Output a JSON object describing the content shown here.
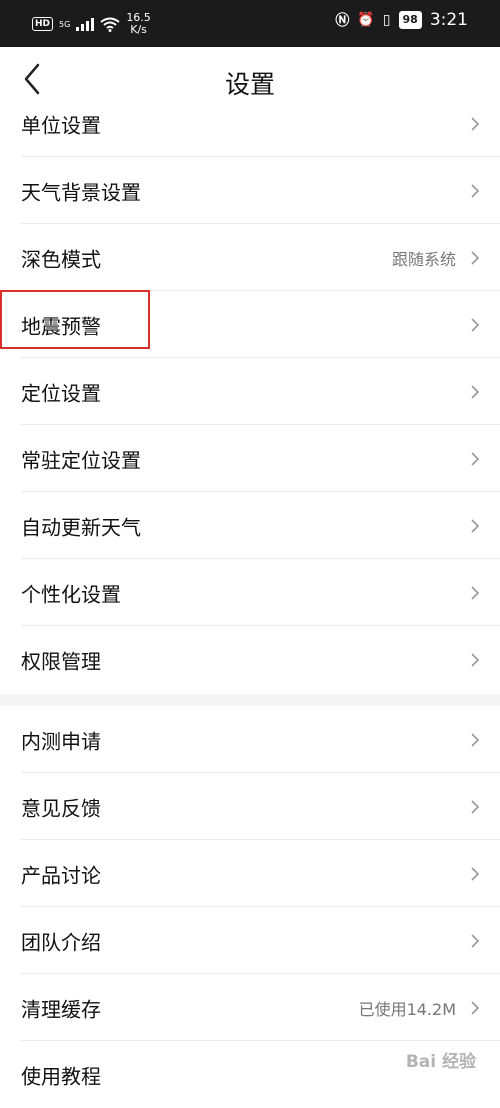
{
  "status_bar": {
    "hd": "HD",
    "network": "5G",
    "speed_value": "16.5",
    "speed_unit": "K/s",
    "battery": "98",
    "time": "3:21"
  },
  "header": {
    "title": "设置",
    "back_icon": "back-chevron-icon"
  },
  "settings": {
    "group1": [
      {
        "label": "单位设置"
      },
      {
        "label": "天气背景设置"
      },
      {
        "label": "深色模式",
        "value": "跟随系统"
      },
      {
        "label": "地震预警"
      },
      {
        "label": "定位设置"
      },
      {
        "label": "常驻定位设置"
      },
      {
        "label": "自动更新天气"
      },
      {
        "label": "个性化设置"
      },
      {
        "label": "权限管理"
      }
    ],
    "group2": [
      {
        "label": "内测申请"
      },
      {
        "label": "意见反馈"
      },
      {
        "label": "产品讨论"
      },
      {
        "label": "团队介绍"
      },
      {
        "label": "清理缓存",
        "value": "已使用14.2M"
      },
      {
        "label": "使用教程"
      }
    ]
  },
  "highlight_color": "#d9302b",
  "watermark": "Bai 经验"
}
